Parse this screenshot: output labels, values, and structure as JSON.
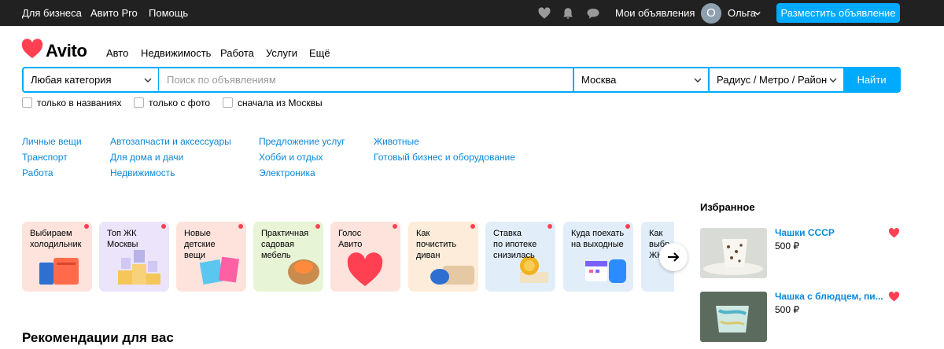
{
  "topbar": {
    "business": "Для бизнеса",
    "pro": "Авито Pro",
    "help": "Помощь",
    "my_ads": "Мои объявления",
    "avatar_letter": "О",
    "user_name": "Ольга",
    "post_button": "Разместить объявление",
    "icons": [
      "heart-icon",
      "bell-icon",
      "chat-icon"
    ]
  },
  "header": {
    "logo_text": "Avito",
    "nav": [
      "Авто",
      "Недвижимость",
      "Работа",
      "Услуги",
      "Ещё"
    ]
  },
  "search": {
    "category": "Любая категория",
    "placeholder": "Поиск по объявлениям",
    "city": "Москва",
    "radius": "Радиус / Метро / Район",
    "button": "Найти"
  },
  "filters": [
    "только в названиях",
    "только с фото",
    "сначала из Москвы"
  ],
  "categories": {
    "col1": [
      "Личные вещи",
      "Транспорт",
      "Работа"
    ],
    "col2": [
      "Автозапчасти и аксессуары",
      "Для дома и дачи",
      "Недвижимость"
    ],
    "col3": [
      "Предложение услуг",
      "Хобби и отдых",
      "Электроника"
    ],
    "col4": [
      "Животные",
      "Готовый бизнес и оборудование"
    ]
  },
  "stories": [
    {
      "lines": [
        "Выбираем",
        "холодильник"
      ],
      "bg": "#fde3dc"
    },
    {
      "lines": [
        "Топ ЖК",
        "Москвы"
      ],
      "bg": "#ece4fa"
    },
    {
      "lines": [
        "Новые",
        "детские",
        "вещи"
      ],
      "bg": "#fde3dc"
    },
    {
      "lines": [
        "Практичная",
        "садовая",
        "мебель"
      ],
      "bg": "#e7f5d6"
    },
    {
      "lines": [
        "Голос",
        "Авито"
      ],
      "bg": "#fde3dc"
    },
    {
      "lines": [
        "Как",
        "почистить",
        "диван"
      ],
      "bg": "#fdecd9"
    },
    {
      "lines": [
        "Ставка",
        "по ипотеке",
        "снизилась"
      ],
      "bg": "#e1eefa"
    },
    {
      "lines": [
        "Куда поехать",
        "на выходные"
      ],
      "bg": "#e1eefa"
    },
    {
      "lines": [
        "Как",
        "выбр",
        "ЖК"
      ],
      "bg": "#e1eefa"
    }
  ],
  "recommendations_title": "Рекомендации для вас",
  "favorites": {
    "title": "Избранное",
    "items": [
      {
        "name": "Чашки СССР",
        "price": "500 ₽"
      },
      {
        "name": "Чашка с блюдцем, пи...",
        "price": "500 ₽"
      }
    ]
  },
  "colors": {
    "accent": "#00aaff",
    "link": "#0a88d8",
    "heart": "#ff4053",
    "topbar": "#212121"
  }
}
